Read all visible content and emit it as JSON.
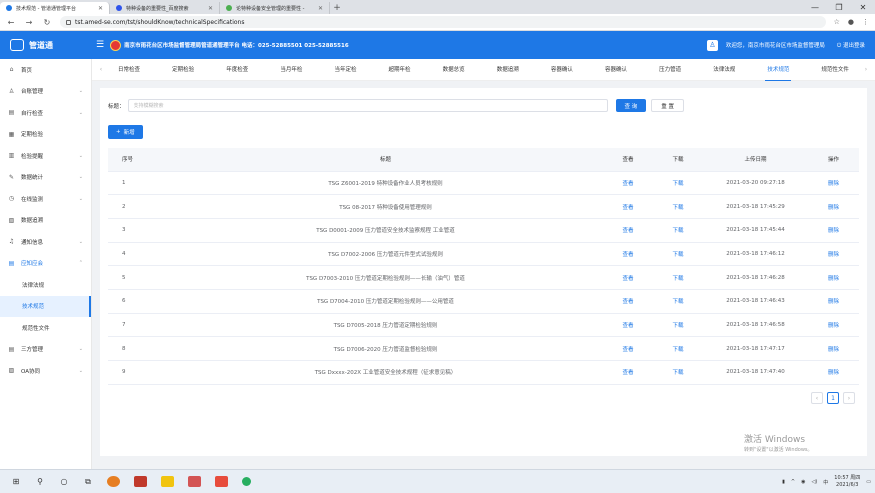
{
  "browser": {
    "tabs": [
      {
        "title": "技术规范 - 管道通管理平台",
        "active": true,
        "color": "#1e78e6"
      },
      {
        "title": "特种设备的重要性_百度搜索",
        "active": false,
        "color": "#2f54eb"
      },
      {
        "title": "论特种设备安全管理的重要性 - ",
        "active": false,
        "color": "#4caf50"
      }
    ],
    "new_tab": "+",
    "url": "tst.amed-se.com/tst/shouldKnow/technicalSpecifications",
    "window_controls": [
      "—",
      "❐",
      "✕"
    ]
  },
  "header": {
    "logo_text": "管道通",
    "menu_toggle": "☰",
    "title": "南京市雨花台区市场监督管理局管道通管理平台 电话：025-52885501 025-52885516",
    "user_icon": "user-icon",
    "welcome": "欢迎您，南京市雨花台区市场监督管理局",
    "logout": "⏻ 退出登录"
  },
  "sidebar": {
    "items": [
      {
        "icon": "⌂",
        "label": "首页",
        "arrow": ""
      },
      {
        "icon": "♙",
        "label": "台账管理",
        "arrow": "⌄"
      },
      {
        "icon": "▤",
        "label": "自行检查",
        "arrow": "⌄"
      },
      {
        "icon": "▦",
        "label": "定期检验",
        "arrow": ""
      },
      {
        "icon": "▥",
        "label": "检验提醒",
        "arrow": "⌄"
      },
      {
        "icon": "✎",
        "label": "数据统计",
        "arrow": "⌄"
      },
      {
        "icon": "◷",
        "label": "在线监测",
        "arrow": "⌄"
      },
      {
        "icon": "▧",
        "label": "数据追溯",
        "arrow": ""
      },
      {
        "icon": "♫",
        "label": "通知信息",
        "arrow": "⌄"
      },
      {
        "icon": "▤",
        "label": "应知应会",
        "arrow": "⌃"
      }
    ],
    "sub_items": [
      {
        "label": "法律法规"
      },
      {
        "label": "技术规范"
      },
      {
        "label": "规范性文件"
      }
    ],
    "bottom_items": [
      {
        "icon": "▤",
        "label": "三方管理",
        "arrow": "⌄"
      },
      {
        "icon": "▨",
        "label": "OA协同",
        "arrow": "⌄"
      }
    ]
  },
  "topnav": {
    "left_arrow": "‹",
    "right_arrow": "›",
    "tabs": [
      "日常检查",
      "定期检验",
      "年度检查",
      "当月年检",
      "当年定检",
      "超期年检",
      "数据总览",
      "数据追溯",
      "容器确认",
      "容器确认",
      "压力管道",
      "法律法规",
      "技术规范",
      "规范性文件"
    ],
    "active_index": 12
  },
  "search": {
    "label": "标题：",
    "placeholder": "支持模糊搜索",
    "query_button": "查 询",
    "reset_button": "重 置"
  },
  "add_button": "新增",
  "table": {
    "headers": [
      "序号",
      "标题",
      "查看",
      "下载",
      "上传日期",
      "操作"
    ],
    "rows": [
      [
        "1",
        "TSG Z6001-2019 特种设备作业人员考核规则",
        "查看",
        "下载",
        "2021-03-20 09:27:18",
        "删除"
      ],
      [
        "2",
        "TSG 08-2017 特种设备使用管理规则",
        "查看",
        "下载",
        "2021-03-18 17:45:29",
        "删除"
      ],
      [
        "3",
        "TSG D0001-2009 压力管道安全技术监察规程 工业管道",
        "查看",
        "下载",
        "2021-03-18 17:45:44",
        "删除"
      ],
      [
        "4",
        "TSG D7002-2006 压力管道元件型式试验规则",
        "查看",
        "下载",
        "2021-03-18 17:46:12",
        "删除"
      ],
      [
        "5",
        "TSG D7003-2010 压力管道定期检验规则——长输（油气）管道",
        "查看",
        "下载",
        "2021-03-18 17:46:28",
        "删除"
      ],
      [
        "6",
        "TSG D7004-2010 压力管道定期检验规则——公用管道",
        "查看",
        "下载",
        "2021-03-18 17:46:43",
        "删除"
      ],
      [
        "7",
        "TSG D7005-2018 压力管道定期检验规则",
        "查看",
        "下载",
        "2021-03-18 17:46:58",
        "删除"
      ],
      [
        "8",
        "TSG D7006-2020 压力管道监督检验规则",
        "查看",
        "下载",
        "2021-03-18 17:47:17",
        "删除"
      ],
      [
        "9",
        "TSG Dxxxx-202X 工业管道安全技术规程（征求意见稿）",
        "查看",
        "下载",
        "2021-03-18 17:47:40",
        "删除"
      ]
    ]
  },
  "pager": {
    "prev": "‹",
    "current": "1",
    "next": "›"
  },
  "watermark": {
    "line1": "激活 Windows",
    "line2": "转到\"设置\"以激活 Windows。"
  },
  "taskbar": {
    "clock_time": "10:57 周四",
    "clock_date": "2021/6/3",
    "ime": "中"
  },
  "colors": {
    "accent": "#1e78e6"
  }
}
